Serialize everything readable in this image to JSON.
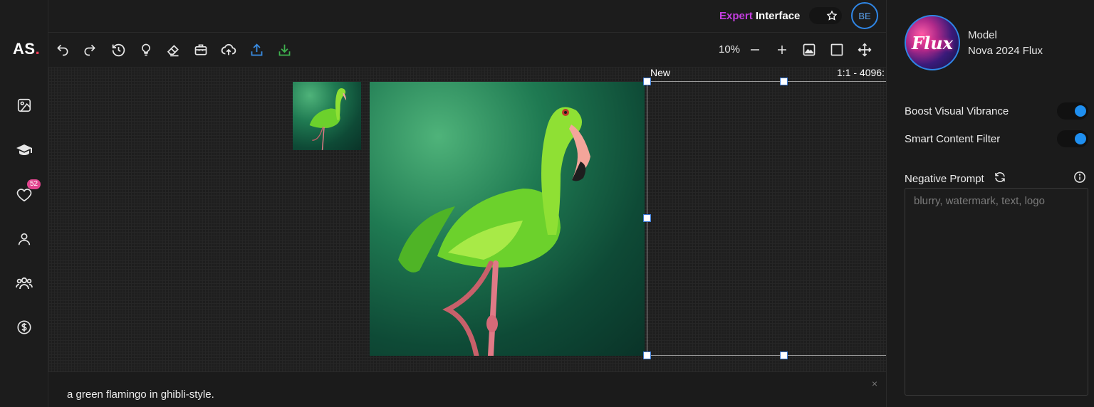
{
  "brand": {
    "logo_text": "AS",
    "logo_dot": "."
  },
  "header": {
    "mode_part1": "Expert",
    "mode_part2": "Interface",
    "avatar_initials": "BE"
  },
  "sidebar": {
    "items": [
      {
        "name": "gallery",
        "icon": "image-icon"
      },
      {
        "name": "learn",
        "icon": "graduation-cap-icon"
      },
      {
        "name": "favorites",
        "icon": "heart-icon",
        "badge": "52"
      },
      {
        "name": "profile",
        "icon": "user-icon"
      },
      {
        "name": "community",
        "icon": "users-icon"
      },
      {
        "name": "billing",
        "icon": "dollar-icon"
      }
    ]
  },
  "toolbar": {
    "zoom_value": "10%",
    "tools": [
      "undo-icon",
      "redo-icon",
      "history-icon",
      "lightbulb-icon",
      "eraser-icon",
      "toolbox-icon",
      "cloud-upload-icon",
      "share-icon",
      "download-icon"
    ],
    "view_tools": [
      "zoom-out-icon",
      "zoom-in-icon",
      "image-frame-icon",
      "square-icon",
      "move-icon"
    ]
  },
  "canvas": {
    "frame_label": "New",
    "frame_ratio": "1:1 - 4096:"
  },
  "prompt": {
    "text": "a green flamingo in ghibli-style.",
    "close": "×"
  },
  "panel": {
    "model_caption": "Model",
    "model_name": "Nova 2024 Flux",
    "model_logo_text": "Flux",
    "toggles": [
      {
        "label": "Boost Visual Vibrance",
        "on": true
      },
      {
        "label": "Smart Content Filter",
        "on": true
      }
    ],
    "negative_prompt_label": "Negative Prompt",
    "negative_prompt_placeholder": "blurry, watermark, text, logo"
  },
  "colors": {
    "accent_blue": "#1f8ff0",
    "expert_magenta": "#c43ee0",
    "badge_pink": "#e2458f",
    "logo_dot_red": "#ff3b57",
    "upload_blue": "#3a8ee6",
    "download_green": "#3fb24f"
  }
}
